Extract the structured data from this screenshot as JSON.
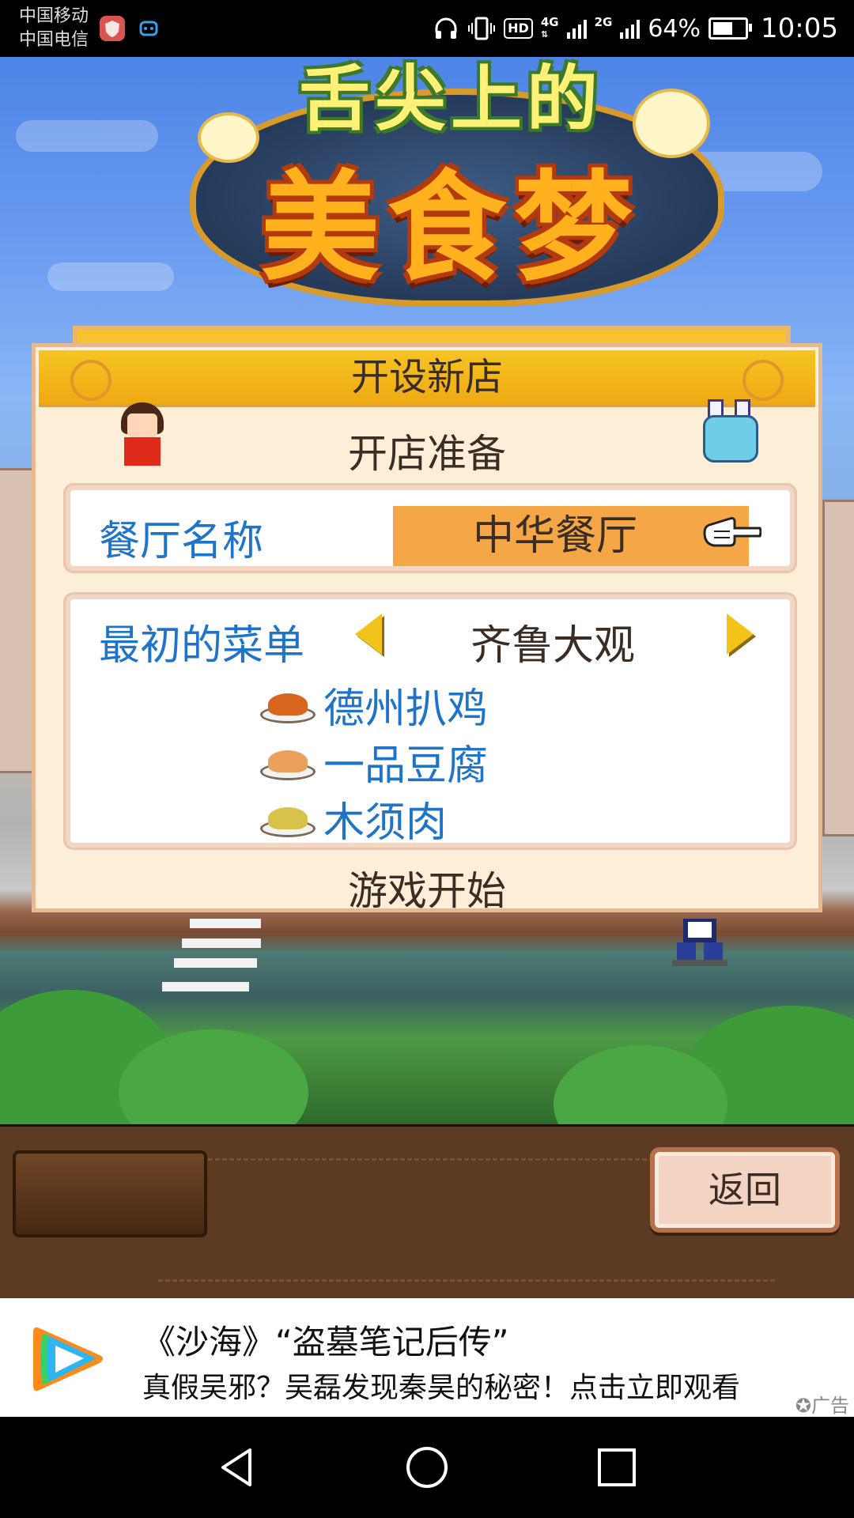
{
  "status_bar": {
    "carrier_1": "中国移动",
    "carrier_2": "中国电信",
    "network_1": "4G",
    "network_2": "2G",
    "hd_label": "HD",
    "battery": "64%",
    "battery_level": 0.64,
    "time": "10:05",
    "icons": [
      "shield-app-icon",
      "robot-app-icon",
      "headphones-icon",
      "vibrate-icon",
      "signal-icon",
      "battery-icon"
    ]
  },
  "game": {
    "logo": {
      "subtitle": "舌尖上的",
      "title": "美食梦"
    },
    "dialog": {
      "header": "开设新店",
      "subtitle": "开店准备",
      "name_label": "餐厅名称",
      "name_value": "中华餐厅",
      "menu_label": "最初的菜单",
      "menu_value": "齐鲁大观",
      "dishes": [
        {
          "name": "德州扒鸡",
          "food_color": "#d9661f"
        },
        {
          "name": "一品豆腐",
          "food_color": "#e9a05a"
        },
        {
          "name": "木须肉",
          "food_color": "#d8c24a"
        }
      ],
      "start_label": "游戏开始"
    },
    "back_label": "返回"
  },
  "ad": {
    "title": "《沙海》“盗墓笔记后传”",
    "description": "真假吴邪？吴磊发现秦昊的秘密！点击立即观看",
    "tag": "广告"
  },
  "colors": {
    "label_blue": "#1f74c9",
    "header_yellow": "#f5c523",
    "name_field": "#f5a646",
    "wood": "#5c3b22"
  }
}
